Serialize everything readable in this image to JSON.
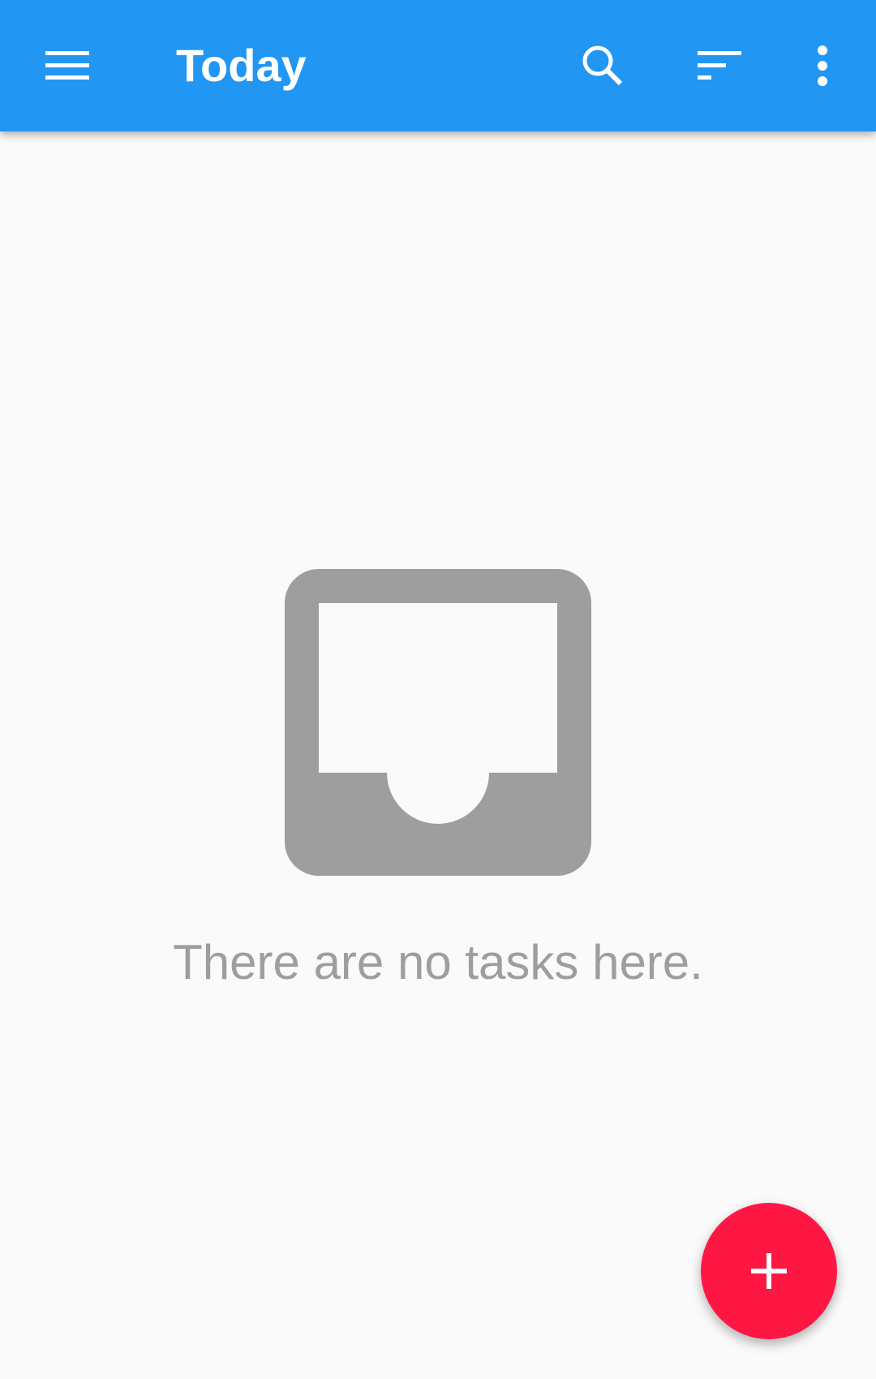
{
  "appbar": {
    "title": "Today",
    "background_color": "#2196f3",
    "icons": [
      "menu-icon",
      "search-icon",
      "sort-icon",
      "more-vert-icon"
    ]
  },
  "empty_state": {
    "icon": "inbox-icon",
    "message": "There are no tasks here."
  },
  "fab": {
    "icon": "add-icon",
    "color": "#ff1744"
  }
}
